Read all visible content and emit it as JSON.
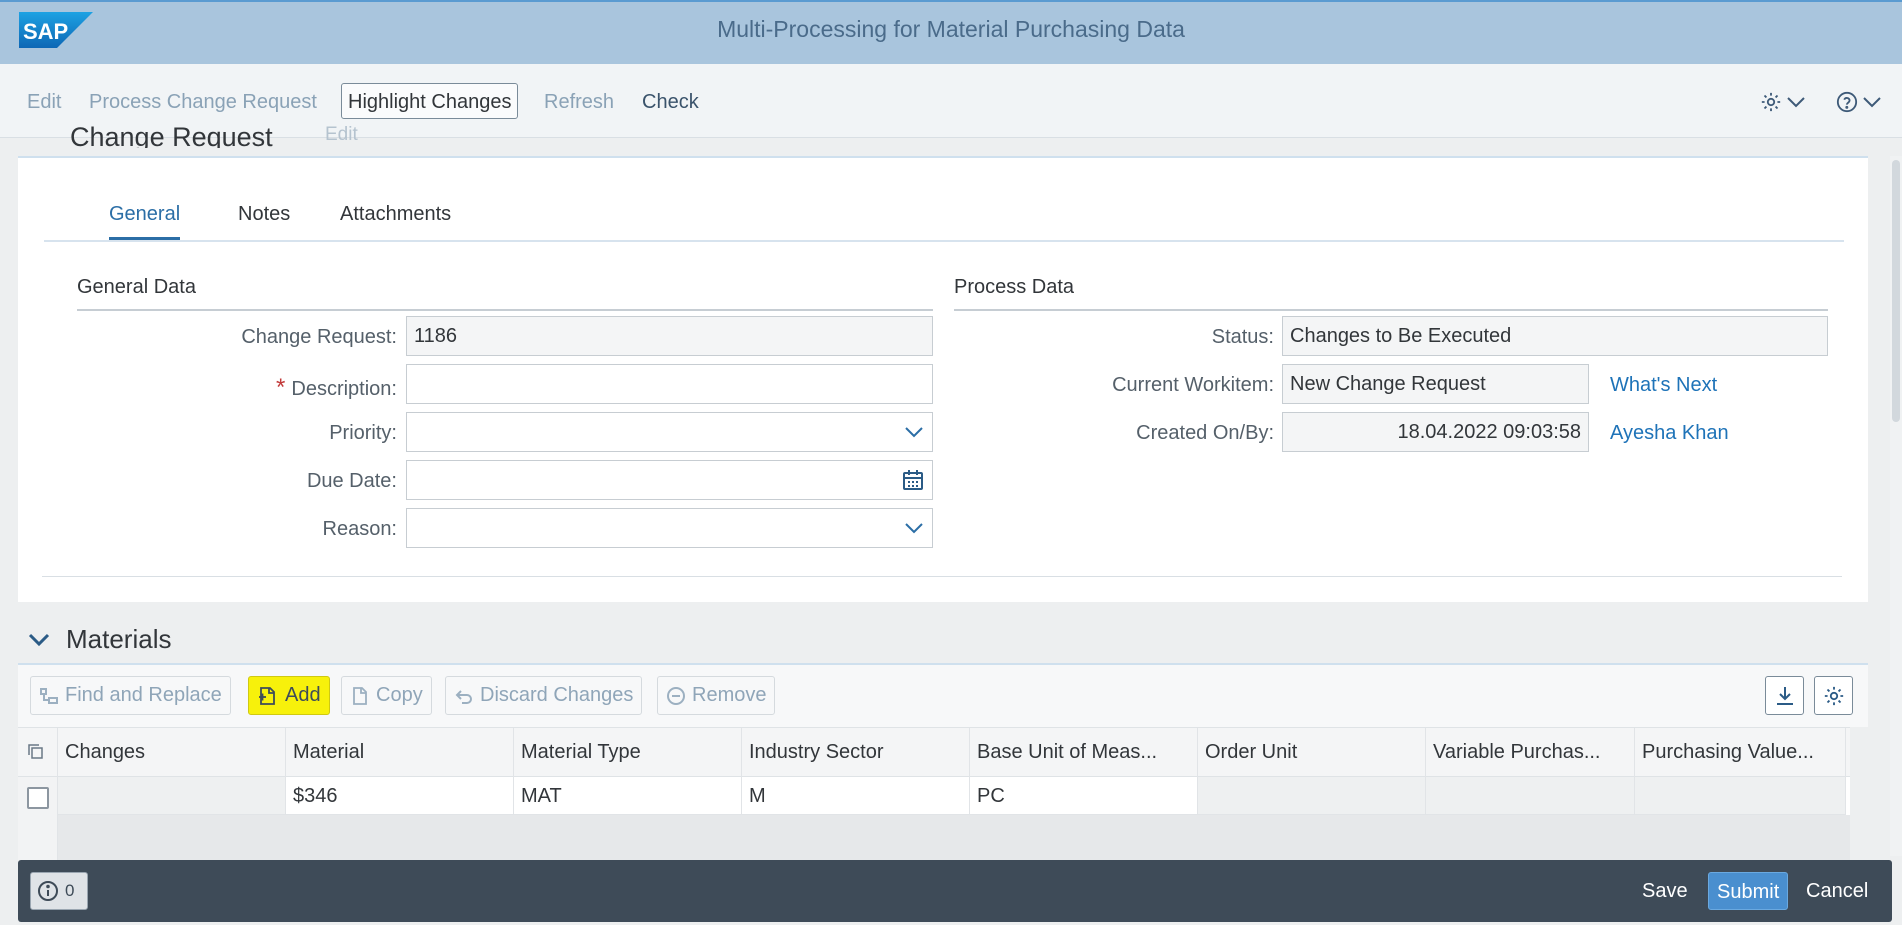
{
  "shell": {
    "title": "Multi-Processing for Material Purchasing Data",
    "logo_text": "SAP"
  },
  "toolbar": {
    "items": [
      "Edit",
      "Process Change Request",
      "Highlight Changes",
      "Refresh",
      "Check"
    ],
    "settings_icon": "gear-icon",
    "help_icon": "help-icon"
  },
  "change_request": {
    "heading": "Change Request",
    "edit_label": "Edit",
    "tabs": [
      "General",
      "Notes",
      "Attachments"
    ],
    "selected_tab": "General",
    "general_data": {
      "title": "General Data",
      "change_request_label": "Change Request:",
      "change_request_value": "1186",
      "required_marker": "*",
      "description_label": "Description:",
      "description_value": "",
      "priority_label": "Priority:",
      "priority_value": "",
      "due_date_label": "Due Date:",
      "due_date_value": "",
      "reason_label": "Reason:",
      "reason_value": ""
    },
    "process_data": {
      "title": "Process Data",
      "status_label": "Status:",
      "status_value": "Changes to Be Executed",
      "workitem_label": "Current Workitem:",
      "workitem_value": "New Change Request",
      "whats_next_link": "What's Next",
      "created_label": "Created On/By:",
      "created_value": "18.04.2022 09:03:58",
      "created_by_link": "Ayesha Khan"
    }
  },
  "materials": {
    "title": "Materials",
    "buttons": {
      "find_replace": "Find and Replace",
      "add": "Add",
      "copy": "Copy",
      "discard": "Discard Changes",
      "remove": "Remove"
    },
    "columns": [
      "Changes",
      "Material",
      "Material Type",
      "Industry Sector",
      "Base Unit of Meas...",
      "Order Unit",
      "Variable Purchas...",
      "Purchasing Value..."
    ],
    "rows": [
      {
        "changes": "",
        "material": "$346",
        "material_type": "MAT",
        "industry_sector": "M",
        "base_unit": "PC",
        "order_unit": "",
        "variable_purchasing": "",
        "purchasing_value": ""
      }
    ]
  },
  "footer": {
    "message_count": "0",
    "save": "Save",
    "submit": "Submit",
    "cancel": "Cancel"
  },
  "colors": {
    "shell_bg": "#a9c5dd",
    "accent": "#2b6ea6",
    "highlight": "#f7f10b",
    "footer_bg": "#3e4b58"
  }
}
